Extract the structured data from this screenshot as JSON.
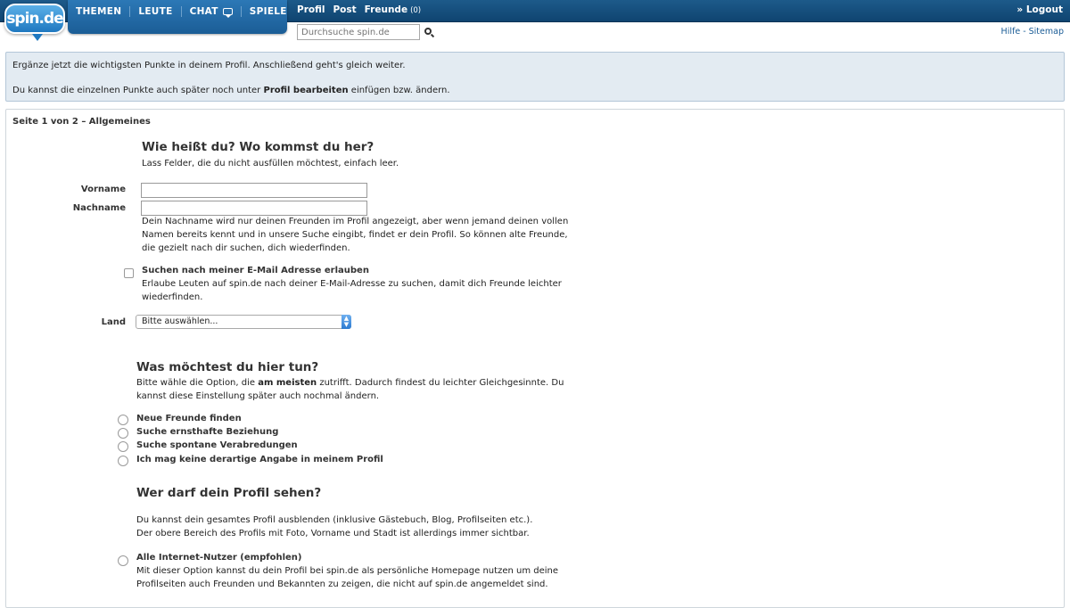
{
  "logo": {
    "text": "spin.de"
  },
  "nav": {
    "items": [
      {
        "label": "THEMEN"
      },
      {
        "label": "LEUTE"
      },
      {
        "label": "CHAT"
      },
      {
        "label": "SPIELE"
      }
    ]
  },
  "subnav": {
    "profil": "Profil",
    "post": "Post",
    "freunde": "Freunde",
    "freunde_count": "(0)"
  },
  "logout": "» Logout",
  "search": {
    "placeholder": "Durchsuche spin.de"
  },
  "help": {
    "hilfe": "Hilfe",
    "sep": " - ",
    "sitemap": "Sitemap"
  },
  "info": {
    "line1": "Ergänze jetzt die wichtigsten Punkte in deinem Profil. Anschließend geht's gleich weiter.",
    "line2_pre": "Du kannst die einzelnen Punkte auch später noch unter ",
    "line2_bold": "Profil bearbeiten",
    "line2_post": " einfügen bzw. ändern."
  },
  "panel": {
    "title": "Seite 1 von 2 – Allgemeines"
  },
  "section1": {
    "heading": "Wie heißt du? Wo kommst du her?",
    "sub": "Lass Felder, die du nicht ausfüllen möchtest, einfach leer.",
    "vorname_label": "Vorname",
    "nachname_label": "Nachname",
    "vorname_value": "",
    "nachname_value": "",
    "nachname_hint_1": "Dein Nachname wird nur deinen Freunden im Profil angezeigt, aber wenn jemand deinen vollen",
    "nachname_hint_2": "Namen bereits kennt und in unsere Suche eingibt, findet er dein Profil. So können alte Freunde,",
    "nachname_hint_3": "die gezielt nach dir suchen, dich wiederfinden.",
    "email_label": "Suchen nach meiner E-Mail Adresse erlauben",
    "email_hint_1": "Erlaube Leuten auf spin.de nach deiner E-Mail-Adresse zu suchen, damit dich Freunde leichter",
    "email_hint_2": "wiederfinden.",
    "land_label": "Land",
    "land_value": "Bitte auswählen..."
  },
  "section2": {
    "heading": "Was möchtest du hier tun?",
    "text_1_pre": "Bitte wähle die Option, die ",
    "text_1_bold": "am meisten",
    "text_1_post": " zutrifft. Dadurch findest du leichter Gleichgesinnte. Du",
    "text_2": "kannst diese Einstellung später auch nochmal ändern.",
    "options": [
      "Neue Freunde finden",
      "Suche ernsthafte Beziehung",
      "Suche spontane Verabredungen",
      "Ich mag keine derartige Angabe in meinem Profil"
    ]
  },
  "section3": {
    "heading": "Wer darf dein Profil sehen?",
    "text_1": "Du kannst dein gesamtes Profil ausblenden (inklusive Gästebuch, Blog, Profilseiten etc.).",
    "text_2": "Der obere Bereich des Profils mit Foto, Vorname und Stadt ist allerdings immer sichtbar.",
    "option_all": "Alle Internet-Nutzer (empfohlen)",
    "option_all_hint_1": "Mit dieser Option kannst du dein Profil bei spin.de als persönliche Homepage nutzen um deine",
    "option_all_hint_2": "Profilseiten auch Freunden und Bekannten zu zeigen, die nicht auf spin.de angemeldet sind."
  }
}
